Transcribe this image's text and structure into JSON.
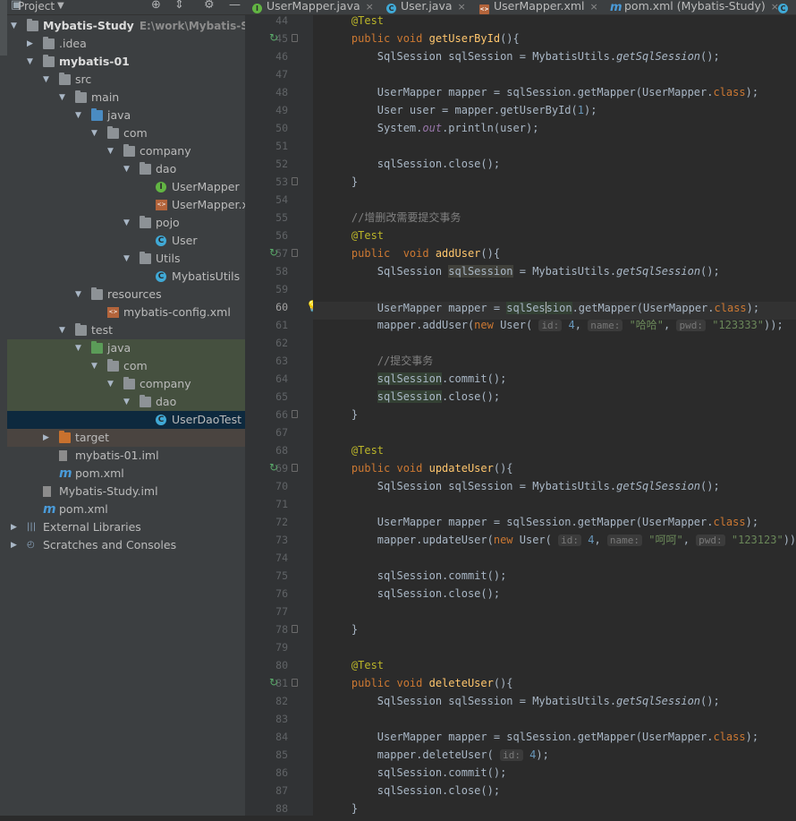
{
  "project_panel": {
    "title": "Project",
    "tree": [
      {
        "depth": 0,
        "arrow": "down",
        "icon": "module",
        "label": "Mybatis-Study",
        "path": "E:\\work\\Mybatis-Study",
        "bold": true
      },
      {
        "depth": 1,
        "arrow": "right",
        "icon": "folder-gray",
        "label": ".idea"
      },
      {
        "depth": 1,
        "arrow": "down",
        "icon": "module",
        "label": "mybatis-01",
        "bold": true
      },
      {
        "depth": 2,
        "arrow": "down",
        "icon": "folder-gray",
        "label": "src"
      },
      {
        "depth": 3,
        "arrow": "down",
        "icon": "folder-gray",
        "label": "main"
      },
      {
        "depth": 4,
        "arrow": "down",
        "icon": "folder-blue",
        "label": "java"
      },
      {
        "depth": 5,
        "arrow": "down",
        "icon": "package",
        "label": "com"
      },
      {
        "depth": 6,
        "arrow": "down",
        "icon": "package",
        "label": "company"
      },
      {
        "depth": 7,
        "arrow": "down",
        "icon": "package",
        "label": "dao"
      },
      {
        "depth": 8,
        "arrow": "none",
        "icon": "interface",
        "label": "UserMapper"
      },
      {
        "depth": 8,
        "arrow": "none",
        "icon": "xml",
        "label": "UserMapper.x"
      },
      {
        "depth": 7,
        "arrow": "down",
        "icon": "package",
        "label": "pojo"
      },
      {
        "depth": 8,
        "arrow": "none",
        "icon": "class",
        "label": "User"
      },
      {
        "depth": 7,
        "arrow": "down",
        "icon": "package",
        "label": "Utils"
      },
      {
        "depth": 8,
        "arrow": "none",
        "icon": "class",
        "label": "MybatisUtils"
      },
      {
        "depth": 4,
        "arrow": "down",
        "icon": "resources",
        "label": "resources"
      },
      {
        "depth": 5,
        "arrow": "none",
        "icon": "xml",
        "label": "mybatis-config.xml"
      },
      {
        "depth": 3,
        "arrow": "down",
        "icon": "folder-gray",
        "label": "test"
      },
      {
        "depth": 4,
        "arrow": "down",
        "icon": "folder-green",
        "label": "java",
        "state": "test-sel"
      },
      {
        "depth": 5,
        "arrow": "down",
        "icon": "package",
        "label": "com",
        "state": "test-sel"
      },
      {
        "depth": 6,
        "arrow": "down",
        "icon": "package",
        "label": "company",
        "state": "test-sel"
      },
      {
        "depth": 7,
        "arrow": "down",
        "icon": "package",
        "label": "dao",
        "state": "test-sel"
      },
      {
        "depth": 8,
        "arrow": "none",
        "icon": "class-test",
        "label": "UserDaoTest",
        "state": "sel"
      },
      {
        "depth": 2,
        "arrow": "right",
        "icon": "folder-orange",
        "label": "target",
        "state": "excl"
      },
      {
        "depth": 2,
        "arrow": "none",
        "icon": "iml",
        "label": "mybatis-01.iml"
      },
      {
        "depth": 2,
        "arrow": "none",
        "icon": "maven",
        "label": "pom.xml"
      },
      {
        "depth": 1,
        "arrow": "none",
        "icon": "iml",
        "label": "Mybatis-Study.iml"
      },
      {
        "depth": 1,
        "arrow": "none",
        "icon": "maven",
        "label": "pom.xml"
      },
      {
        "depth": 0,
        "arrow": "right",
        "icon": "libraries",
        "label": "External Libraries"
      },
      {
        "depth": 0,
        "arrow": "right",
        "icon": "scratches",
        "label": "Scratches and Consoles"
      }
    ]
  },
  "editor_tabs": [
    {
      "label": "UserMapper.java",
      "icon": "interface"
    },
    {
      "label": "User.java",
      "icon": "class"
    },
    {
      "label": "UserMapper.xml",
      "icon": "xml"
    },
    {
      "label": "pom.xml (Mybatis-Study)",
      "icon": "maven"
    }
  ],
  "editor": {
    "current_line": 60,
    "lines": [
      {
        "n": 44,
        "parts": [
          [
            "an",
            "    @Test"
          ]
        ]
      },
      {
        "n": 45,
        "run": true,
        "fold": true,
        "parts": [
          [
            "kw",
            "    public void "
          ],
          [
            "fn",
            "getUserById"
          ],
          [
            "",
            "(){"
          ]
        ]
      },
      {
        "n": 46,
        "parts": [
          [
            "",
            "        SqlSession sqlSession = MybatisUtils."
          ],
          [
            "it",
            "getSqlSession"
          ],
          [
            "",
            "();"
          ]
        ]
      },
      {
        "n": 47,
        "parts": []
      },
      {
        "n": 48,
        "parts": [
          [
            "",
            "        UserMapper mapper = sqlSession.getMapper(UserMapper."
          ],
          [
            "kw",
            "class"
          ],
          [
            "",
            ");"
          ]
        ]
      },
      {
        "n": 49,
        "parts": [
          [
            "",
            "        User user = mapper.getUserById("
          ],
          [
            "num",
            "1"
          ],
          [
            "",
            ");"
          ]
        ]
      },
      {
        "n": 50,
        "parts": [
          [
            "",
            "        System."
          ],
          [
            "fld",
            "out"
          ],
          [
            "",
            ".println(user);"
          ]
        ]
      },
      {
        "n": 51,
        "parts": []
      },
      {
        "n": 52,
        "parts": [
          [
            "",
            "        sqlSession.close();"
          ]
        ]
      },
      {
        "n": 53,
        "fold": true,
        "parts": [
          [
            "",
            "    }"
          ]
        ]
      },
      {
        "n": 54,
        "parts": []
      },
      {
        "n": 55,
        "parts": [
          [
            "cm",
            "    //增删改需要提交事务"
          ]
        ]
      },
      {
        "n": 56,
        "parts": [
          [
            "an",
            "    @Test"
          ]
        ]
      },
      {
        "n": 57,
        "run": true,
        "fold": true,
        "parts": [
          [
            "kw",
            "    public  void "
          ],
          [
            "fn",
            "addUser"
          ],
          [
            "",
            "(){"
          ]
        ]
      },
      {
        "n": 58,
        "parts": [
          [
            "",
            "        SqlSession "
          ],
          [
            "hlb",
            "sqlSession"
          ],
          [
            "",
            " = MybatisUtils."
          ],
          [
            "it",
            "getSqlSession"
          ],
          [
            "",
            "();"
          ]
        ]
      },
      {
        "n": 59,
        "parts": []
      },
      {
        "n": 60,
        "bulb": true,
        "parts": [
          [
            "",
            "        UserMapper mapper = "
          ],
          [
            "hl",
            "sqlSes"
          ],
          [
            "caret",
            ""
          ],
          [
            "hl",
            "sion"
          ],
          [
            "",
            ".getMapper(UserMapper."
          ],
          [
            "kw",
            "class"
          ],
          [
            "",
            ");"
          ]
        ]
      },
      {
        "n": 61,
        "parts": [
          [
            "",
            "        mapper.addUser("
          ],
          [
            "kw",
            "new "
          ],
          [
            "",
            "User( "
          ],
          [
            "hint",
            "id:"
          ],
          [
            "num",
            " 4"
          ],
          [
            "",
            ", "
          ],
          [
            "hint",
            "name:"
          ],
          [
            "st",
            " \"哈哈\""
          ],
          [
            "",
            ", "
          ],
          [
            "hint",
            "pwd:"
          ],
          [
            "st",
            " \"123333\""
          ],
          [
            "",
            "));"
          ]
        ]
      },
      {
        "n": 62,
        "parts": []
      },
      {
        "n": 63,
        "parts": [
          [
            "cm",
            "        //提交事务"
          ]
        ]
      },
      {
        "n": 64,
        "parts": [
          [
            "",
            "        "
          ],
          [
            "hl",
            "sqlSession"
          ],
          [
            "",
            ".commit();"
          ]
        ]
      },
      {
        "n": 65,
        "parts": [
          [
            "",
            "        "
          ],
          [
            "hl",
            "sqlSession"
          ],
          [
            "",
            ".close();"
          ]
        ]
      },
      {
        "n": 66,
        "fold": true,
        "parts": [
          [
            "",
            "    }"
          ]
        ]
      },
      {
        "n": 67,
        "parts": []
      },
      {
        "n": 68,
        "parts": [
          [
            "an",
            "    @Test"
          ]
        ]
      },
      {
        "n": 69,
        "run": true,
        "fold": true,
        "parts": [
          [
            "kw",
            "    public void "
          ],
          [
            "fn",
            "updateUser"
          ],
          [
            "",
            "(){"
          ]
        ]
      },
      {
        "n": 70,
        "parts": [
          [
            "",
            "        SqlSession sqlSession = MybatisUtils."
          ],
          [
            "it",
            "getSqlSession"
          ],
          [
            "",
            "();"
          ]
        ]
      },
      {
        "n": 71,
        "parts": []
      },
      {
        "n": 72,
        "parts": [
          [
            "",
            "        UserMapper mapper = sqlSession.getMapper(UserMapper."
          ],
          [
            "kw",
            "class"
          ],
          [
            "",
            ");"
          ]
        ]
      },
      {
        "n": 73,
        "parts": [
          [
            "",
            "        mapper.updateUser("
          ],
          [
            "kw",
            "new "
          ],
          [
            "",
            "User( "
          ],
          [
            "hint",
            "id:"
          ],
          [
            "num",
            " 4"
          ],
          [
            "",
            ", "
          ],
          [
            "hint",
            "name:"
          ],
          [
            "st",
            " \"呵呵\""
          ],
          [
            "",
            ", "
          ],
          [
            "hint",
            "pwd:"
          ],
          [
            "st",
            " \"123123\""
          ],
          [
            "",
            "));"
          ]
        ]
      },
      {
        "n": 74,
        "parts": []
      },
      {
        "n": 75,
        "parts": [
          [
            "",
            "        sqlSession.commit();"
          ]
        ]
      },
      {
        "n": 76,
        "parts": [
          [
            "",
            "        sqlSession.close();"
          ]
        ]
      },
      {
        "n": 77,
        "parts": []
      },
      {
        "n": 78,
        "fold": true,
        "parts": [
          [
            "",
            "    }"
          ]
        ]
      },
      {
        "n": 79,
        "parts": []
      },
      {
        "n": 80,
        "parts": [
          [
            "an",
            "    @Test"
          ]
        ]
      },
      {
        "n": 81,
        "run": true,
        "fold": true,
        "parts": [
          [
            "kw",
            "    public void "
          ],
          [
            "fn",
            "deleteUser"
          ],
          [
            "",
            "(){"
          ]
        ]
      },
      {
        "n": 82,
        "parts": [
          [
            "",
            "        SqlSession sqlSession = MybatisUtils."
          ],
          [
            "it",
            "getSqlSession"
          ],
          [
            "",
            "();"
          ]
        ]
      },
      {
        "n": 83,
        "parts": []
      },
      {
        "n": 84,
        "parts": [
          [
            "",
            "        UserMapper mapper = sqlSession.getMapper(UserMapper."
          ],
          [
            "kw",
            "class"
          ],
          [
            "",
            ");"
          ]
        ]
      },
      {
        "n": 85,
        "parts": [
          [
            "",
            "        mapper.deleteUser( "
          ],
          [
            "hint",
            "id:"
          ],
          [
            "num",
            " 4"
          ],
          [
            "",
            ");"
          ]
        ]
      },
      {
        "n": 86,
        "parts": [
          [
            "",
            "        sqlSession.commit();"
          ]
        ]
      },
      {
        "n": 87,
        "parts": [
          [
            "",
            "        sqlSession.close();"
          ]
        ]
      },
      {
        "n": 88,
        "parts": [
          [
            "",
            "    }"
          ]
        ]
      }
    ]
  },
  "colors": {
    "editor_bg": "#2b2b2b",
    "panel_bg": "#3c3f41",
    "keyword": "#cc7832",
    "annotation": "#bbb529",
    "method": "#ffc66d",
    "string": "#6a8759",
    "comment": "#808080",
    "number": "#6897bb",
    "selection": "#0d293e"
  }
}
